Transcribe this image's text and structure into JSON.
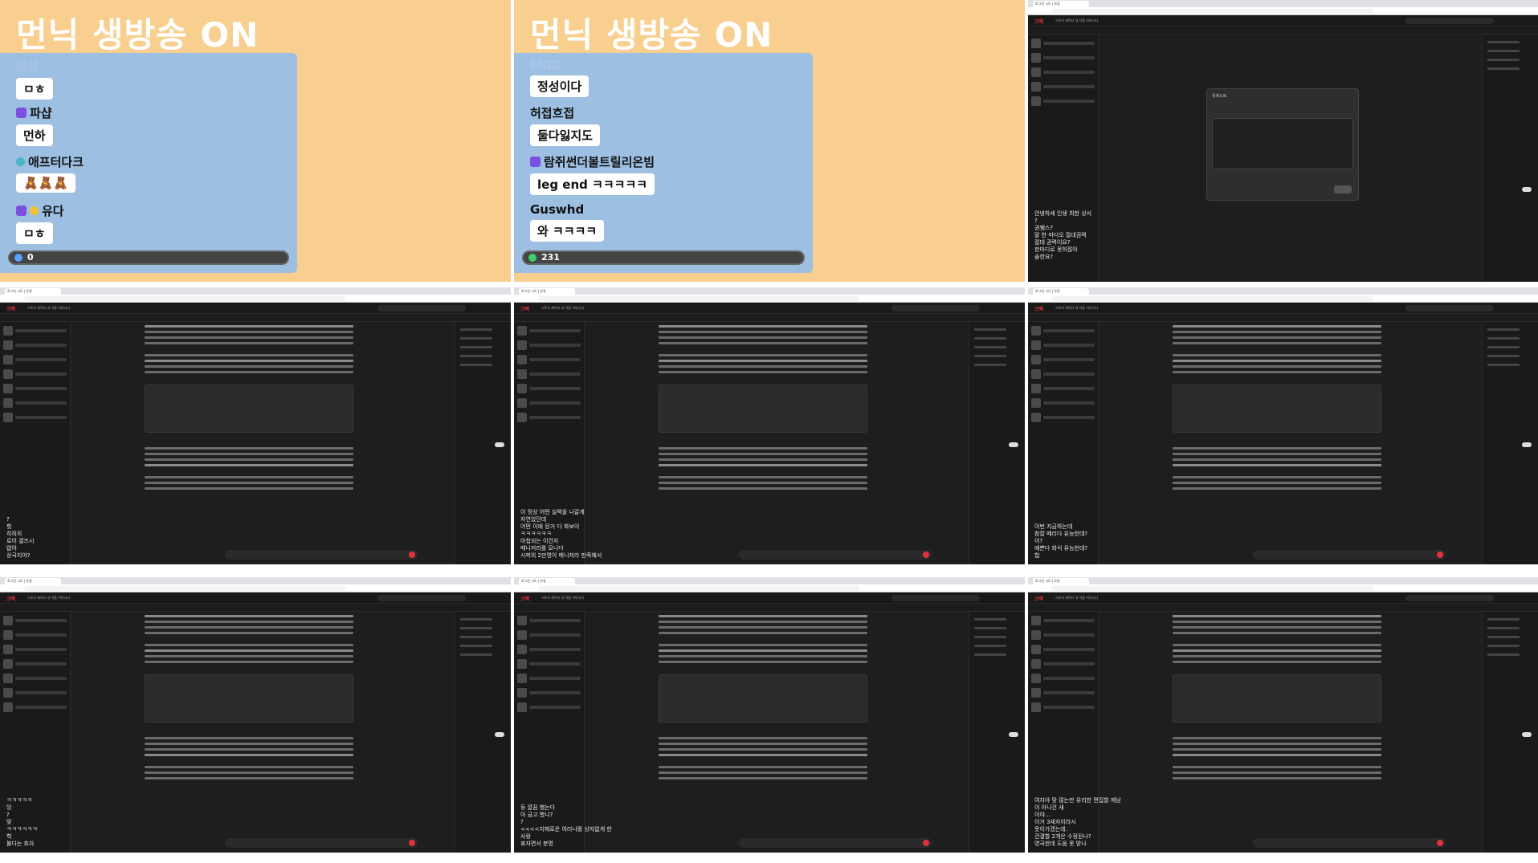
{
  "stream_left": {
    "headline": "먼닉 생방송 ON",
    "chat": [
      {
        "user": "이샘",
        "msg": "ㅁㅎ",
        "faded": true
      },
      {
        "user": "파샵",
        "msg": "먼하",
        "badge": "heart"
      },
      {
        "user": "애프터다크",
        "msg": "🧸🧸🧸",
        "badge": "dot"
      },
      {
        "user": "유다",
        "msg": "ㅁㅎ",
        "badge": "heart"
      }
    ],
    "viewer_count": "0"
  },
  "stream_right": {
    "headline": "먼닉 생방송 ON",
    "chat": [
      {
        "user": "MGO",
        "msg": "정성이다",
        "faded": true
      },
      {
        "user": "허접흐접",
        "msg": "둘다잃지도"
      },
      {
        "user": "람쥐썬더볼트릴리온빔",
        "msg": "leg end ㅋㅋㅋㅋㅋ",
        "badge": "heart"
      },
      {
        "user": "Guswhd",
        "msg": "와 ㅋㅋㅋㅋ"
      }
    ],
    "viewer_count": "231"
  },
  "browser": {
    "tab_title": "로그인 시도 | 유튜",
    "logo": "크랙",
    "nav": "스토리  캐릭터  내 작품  커뮤니티",
    "modal_title": "유저노트"
  },
  "captions": {
    "p3": [
      "안녕하세 인생 최한 상서",
      "?",
      "권쌤스?",
      "말 한 마디오 절대권력",
      "절대 권력이요?",
      "한마디로 못하잖아",
      "솔한요?"
    ],
    "p4": [
      "?",
      "헛",
      "히히히",
      "로이 결즈시",
      "얍아",
      "상국지야?"
    ],
    "p5": [
      "이 정상 어떤 실력을 나갈게",
      "자연었던데",
      "어떤 이에 된거 다 화보이",
      "ㅋㅋㅋㅋㅋㅋ",
      "아칩되는 이건지",
      "메니저라를 모니다",
      "시퍼의 2만명이 메니저라 만족해서"
    ],
    "p6": [
      "이번 지금하는데",
      "참잘 메리다 유능한데?",
      "이?",
      "예쁜다 화식 유능한데?",
      "헙"
    ],
    "p7": [
      "ㅋㅋㅋㅋㅋ",
      "잉",
      "?",
      "맞",
      "ㅋㅋㅋㅋㅋㅋ",
      "헉",
      "불다는 흐자"
    ],
    "p8": [
      "등 깔끔 했는다",
      "아 금고 했니?",
      "?",
      "<<<<지해로운 여러나를 상자없게 한",
      "사랑",
      "휴자면서 분명"
    ],
    "p9": [
      "여자야 맞 많는만 유리한 편집할 제남",
      "이 아니건 새",
      "이야...",
      "이거 3세자이라시",
      "못이가겠는데.",
      "건결할 2개은 수정된나?",
      "영국한데 도움 못 받나"
    ]
  }
}
